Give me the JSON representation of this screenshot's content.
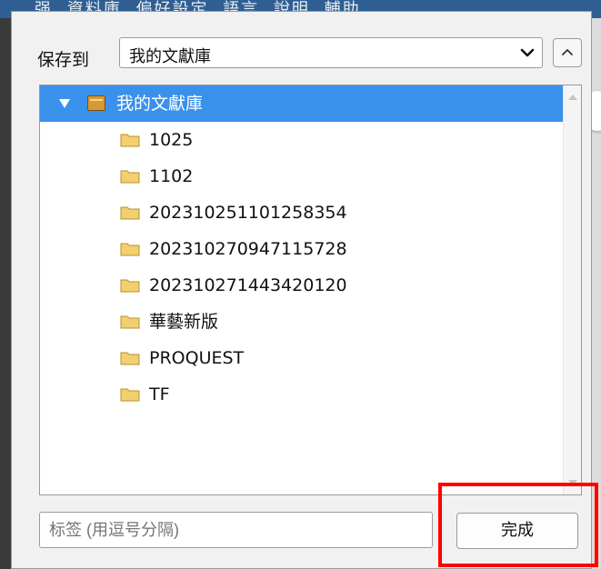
{
  "background": {
    "menu_text": "强 資料庫 偏好設定 語言 說明 輔助"
  },
  "dialog": {
    "save_to_label": "保存到",
    "library_select": {
      "value": "我的文獻庫",
      "dropdown_icon": "chevron-down-icon"
    },
    "toggle_button_icon": "chevron-up-icon",
    "tree": {
      "root": {
        "label": "我的文獻庫",
        "expanded": true,
        "selected": true,
        "icon": "library-icon"
      },
      "collections": [
        {
          "label": "1025",
          "icon": "folder-icon"
        },
        {
          "label": "1102",
          "icon": "folder-icon"
        },
        {
          "label": "202310251101258354",
          "icon": "folder-icon"
        },
        {
          "label": "202310270947115728",
          "icon": "folder-icon"
        },
        {
          "label": "202310271443420120",
          "icon": "folder-icon"
        },
        {
          "label": "華藝新版",
          "icon": "folder-icon"
        },
        {
          "label": "PROQUEST",
          "icon": "folder-icon"
        },
        {
          "label": "TF",
          "icon": "folder-icon"
        }
      ]
    },
    "tags_input": {
      "placeholder": "标签 (用逗号分隔)",
      "value": ""
    },
    "done_button": "完成"
  },
  "colors": {
    "selection": "#3a91ec",
    "highlight_box": "#ff0000",
    "folder": "#f2cf6f",
    "library": "#d59a33"
  }
}
